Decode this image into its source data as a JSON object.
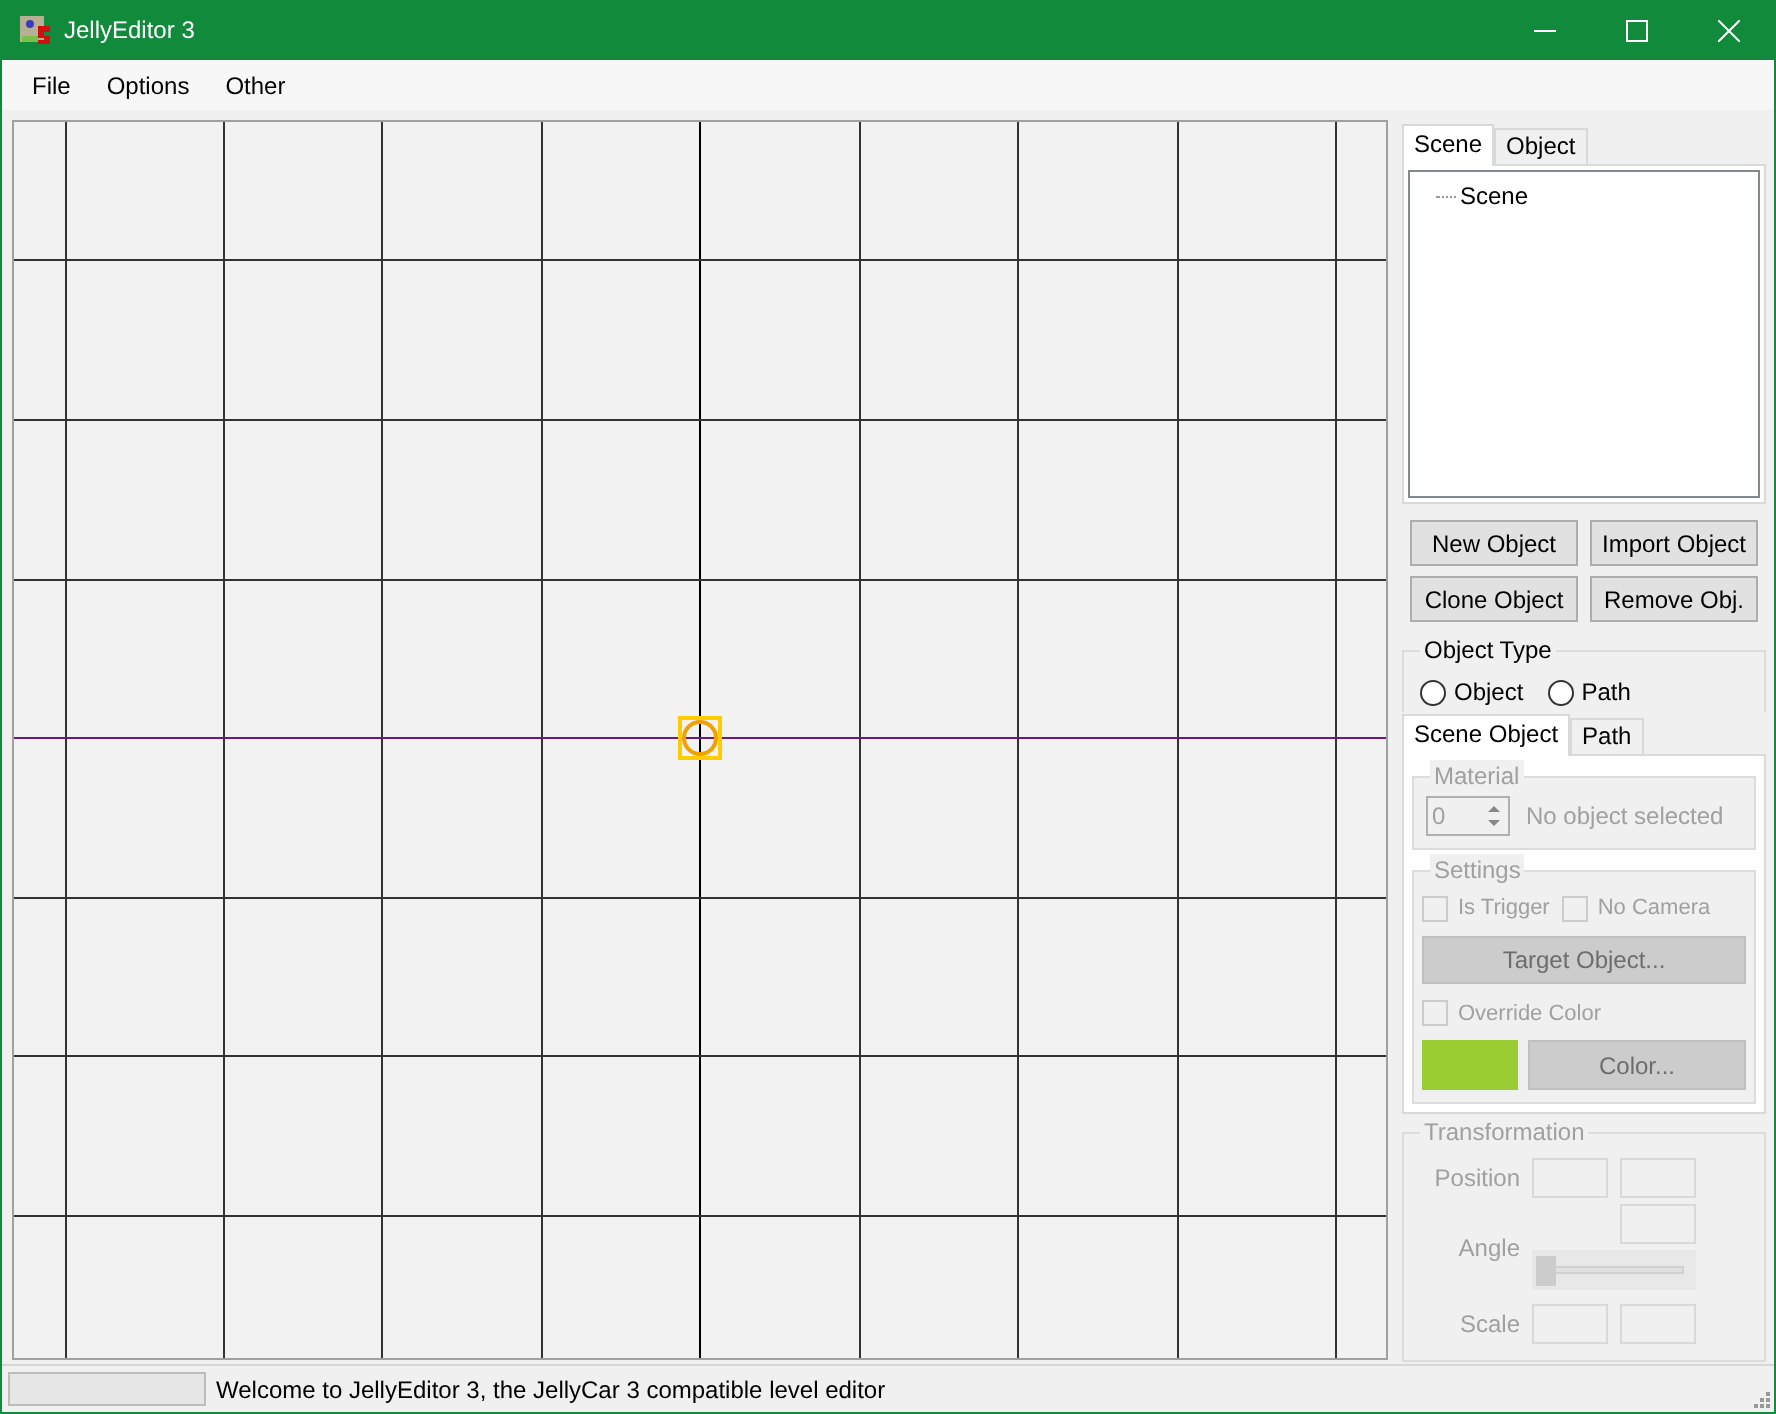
{
  "window": {
    "title": "JellyEditor 3"
  },
  "menu": [
    "File",
    "Options",
    "Other"
  ],
  "side_tabs": [
    {
      "label": "Scene",
      "selected": true
    },
    {
      "label": "Object",
      "selected": false
    }
  ],
  "tree": [
    {
      "label": "Scene"
    }
  ],
  "scene_buttons": [
    "New Object",
    "Import Object",
    "Clone Object",
    "Remove Obj."
  ],
  "object_type": {
    "label": "Object Type",
    "options": [
      {
        "label": "Object",
        "selected": false
      },
      {
        "label": "Path",
        "selected": false
      }
    ]
  },
  "inner_tabs": [
    {
      "label": "Scene Object",
      "selected": true
    },
    {
      "label": "Path",
      "selected": false
    }
  ],
  "material": {
    "label": "Material",
    "value": "0",
    "status": "No object selected",
    "disabled": true
  },
  "settings": {
    "label": "Settings",
    "disabled": true,
    "checkboxes": [
      {
        "label": "Is Trigger",
        "checked": false
      },
      {
        "label": "No Camera",
        "checked": false
      }
    ],
    "target_button": "Target Object...",
    "override": {
      "label": "Override Color",
      "checked": false
    },
    "color": "#9acd32",
    "color_button": "Color..."
  },
  "transformation": {
    "label": "Transformation",
    "disabled": true,
    "position": "Position",
    "angle": "Angle",
    "angle_slider": {
      "level": 0
    },
    "scale": "Scale"
  },
  "status_bar": {
    "progress": {
      "level": 0
    },
    "text": "Welcome to JellyEditor 3, the JellyCar 3 compatible level editor"
  }
}
